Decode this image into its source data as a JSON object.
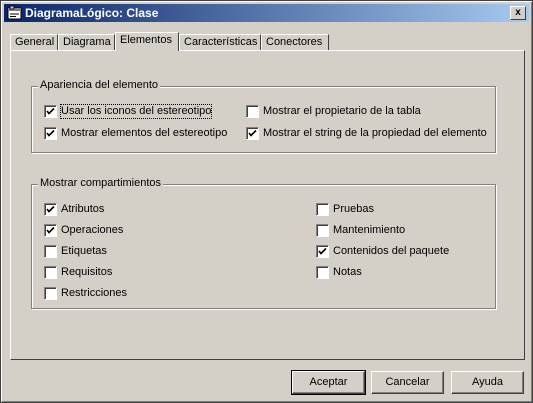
{
  "window": {
    "title": "DiagramaLógico: Clase",
    "close_glyph": "x"
  },
  "tabs": [
    {
      "label": "General",
      "active": false
    },
    {
      "label": "Diagrama",
      "active": false
    },
    {
      "label": "Elementos",
      "active": true
    },
    {
      "label": "Características",
      "active": false
    },
    {
      "label": "Conectores",
      "active": false
    }
  ],
  "appearance": {
    "title": "Apariencia del elemento",
    "options": [
      {
        "label": "Usar los iconos del estereotipo",
        "checked": true
      },
      {
        "label": "Mostrar elementos del estereotipo",
        "checked": true
      },
      {
        "label": "Mostrar el propietario de la tabla",
        "checked": false
      },
      {
        "label": "Mostrar el string de la propiedad del elemento",
        "checked": true
      }
    ]
  },
  "compartments": {
    "title": "Mostrar compartimientos",
    "options": [
      {
        "label": "Atributos",
        "checked": true
      },
      {
        "label": "Operaciones",
        "checked": true
      },
      {
        "label": "Etiquetas",
        "checked": false
      },
      {
        "label": "Requisitos",
        "checked": false
      },
      {
        "label": "Restricciones",
        "checked": false
      },
      {
        "label": "Pruebas",
        "checked": false
      },
      {
        "label": "Mantenimiento",
        "checked": false
      },
      {
        "label": "Contenidos del paquete",
        "checked": true
      },
      {
        "label": "Notas",
        "checked": false
      }
    ]
  },
  "buttons": {
    "ok": "Aceptar",
    "cancel": "Cancelar",
    "help": "Ayuda"
  }
}
